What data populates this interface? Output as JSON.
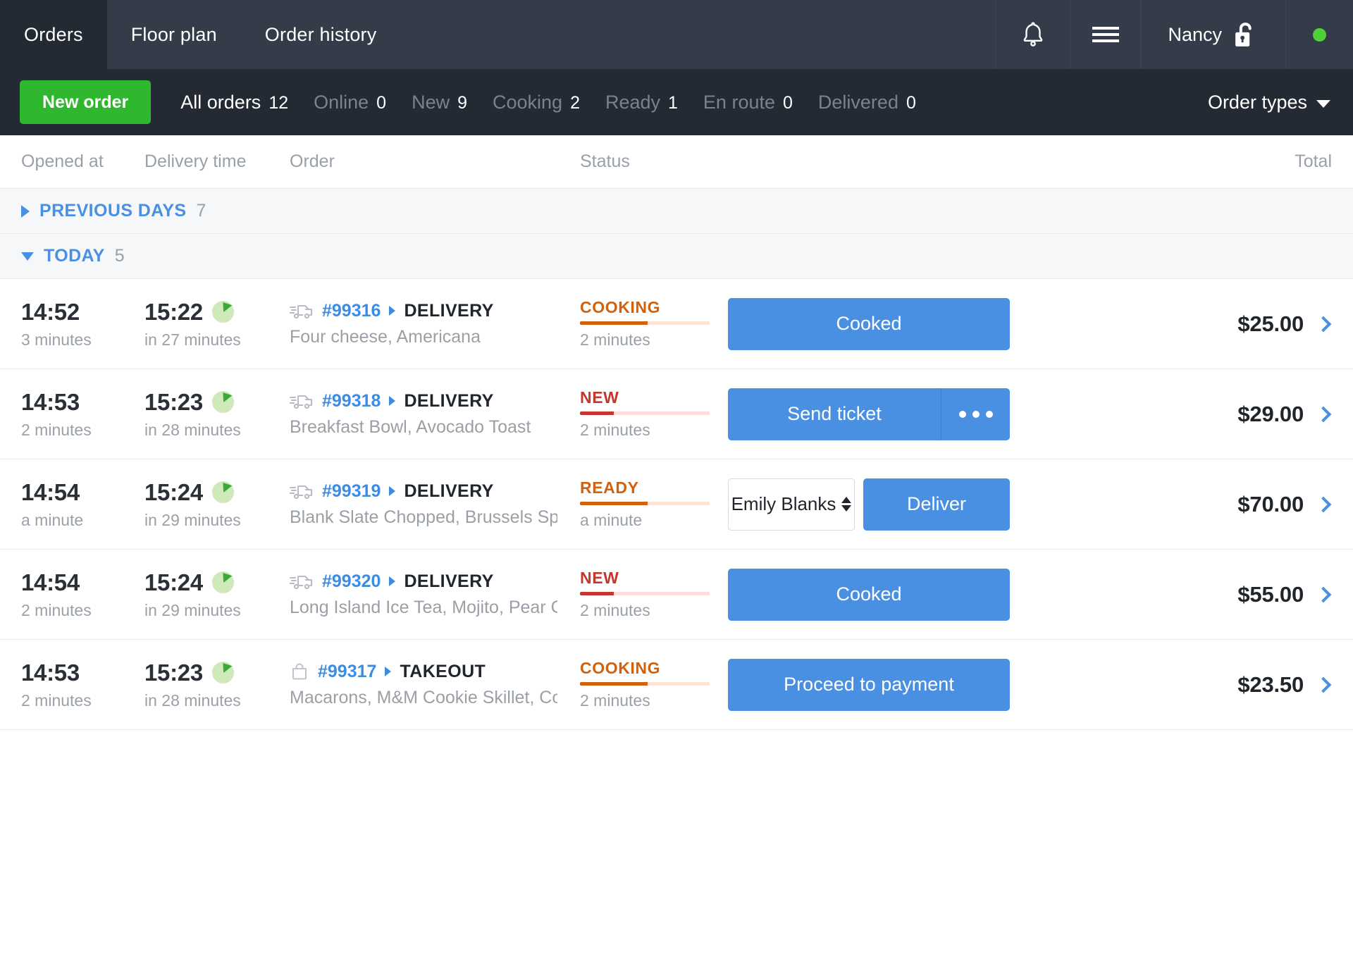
{
  "topbar": {
    "nav": [
      {
        "label": "Orders",
        "active": true
      },
      {
        "label": "Floor plan",
        "active": false
      },
      {
        "label": "Order history",
        "active": false
      }
    ],
    "bell_icon": "bell-icon",
    "menu_icon": "hamburger-menu-icon",
    "user_name": "Nancy",
    "lock_icon": "unlock-padlock-icon",
    "status_dot_color": "#4cd137"
  },
  "filterbar": {
    "new_order_label": "New order",
    "tabs": [
      {
        "label": "All orders",
        "count": "12",
        "active": true
      },
      {
        "label": "Online",
        "count": "0",
        "active": false
      },
      {
        "label": "New",
        "count": "9",
        "active": false
      },
      {
        "label": "Cooking",
        "count": "2",
        "active": false
      },
      {
        "label": "Ready",
        "count": "1",
        "active": false
      },
      {
        "label": "En route",
        "count": "0",
        "active": false
      },
      {
        "label": "Delivered",
        "count": "0",
        "active": false
      }
    ],
    "order_types_label": "Order types"
  },
  "table": {
    "headers": {
      "opened_at": "Opened at",
      "delivery_time": "Delivery time",
      "order": "Order",
      "status": "Status",
      "total": "Total"
    },
    "groups": [
      {
        "title": "PREVIOUS DAYS",
        "count": "7",
        "expanded": false
      },
      {
        "title": "TODAY",
        "count": "5",
        "expanded": true
      }
    ],
    "rows": [
      {
        "opened_at": "14:52",
        "opened_ago": "3 minutes",
        "delivery_at": "15:22",
        "delivery_in": "in 27 minutes",
        "type_icon": "delivery-truck-icon",
        "order_id": "#99316",
        "order_type": "DELIVERY",
        "items": "Four cheese, Americana",
        "status_label": "COOKING",
        "status_kind": "cooking",
        "status_progress": 52,
        "status_sub": "2 minutes",
        "action_kind": "primary",
        "action_label": "Cooked",
        "total": "$25.00"
      },
      {
        "opened_at": "14:53",
        "opened_ago": "2 minutes",
        "delivery_at": "15:23",
        "delivery_in": "in 28 minutes",
        "type_icon": "delivery-truck-icon",
        "order_id": "#99318",
        "order_type": "DELIVERY",
        "items": "Breakfast Bowl, Avocado Toast",
        "status_label": "NEW",
        "status_kind": "new",
        "status_progress": 26,
        "status_sub": "2 minutes",
        "action_kind": "split",
        "action_label": "Send ticket",
        "more_icon": "ellipsis-icon",
        "total": "$29.00"
      },
      {
        "opened_at": "14:54",
        "opened_ago": "a minute",
        "delivery_at": "15:24",
        "delivery_in": "in 29 minutes",
        "type_icon": "delivery-truck-icon",
        "order_id": "#99319",
        "order_type": "DELIVERY",
        "items": "Blank Slate Chopped, Brussels Sp…",
        "status_label": "READY",
        "status_kind": "ready",
        "status_progress": 52,
        "status_sub": "a minute",
        "action_kind": "assign",
        "assignee": "Emily Blanks",
        "action_label": "Deliver",
        "total": "$70.00"
      },
      {
        "opened_at": "14:54",
        "opened_ago": "2 minutes",
        "delivery_at": "15:24",
        "delivery_in": "in 29 minutes",
        "type_icon": "delivery-truck-icon",
        "order_id": "#99320",
        "order_type": "DELIVERY",
        "items": "Long Island Ice Tea, Mojito, Pear C…",
        "status_label": "NEW",
        "status_kind": "new",
        "status_progress": 26,
        "status_sub": "2 minutes",
        "action_kind": "primary",
        "action_label": "Cooked",
        "total": "$55.00"
      },
      {
        "opened_at": "14:53",
        "opened_ago": "2 minutes",
        "delivery_at": "15:23",
        "delivery_in": "in 28 minutes",
        "type_icon": "takeout-bag-icon",
        "order_id": "#99317",
        "order_type": "TAKEOUT",
        "items": "Macarons, M&M Cookie Skillet, Co…",
        "status_label": "COOKING",
        "status_kind": "cooking",
        "status_progress": 52,
        "status_sub": "2 minutes",
        "action_kind": "primary",
        "action_label": "Proceed to payment",
        "total": "$23.50"
      }
    ]
  },
  "colors": {
    "accent_blue": "#4a90e2",
    "green": "#2fb82f",
    "orange": "#d2610d",
    "red": "#c6362f",
    "topbar_dark": "#343c49",
    "filterbar_dark": "#242a33"
  }
}
